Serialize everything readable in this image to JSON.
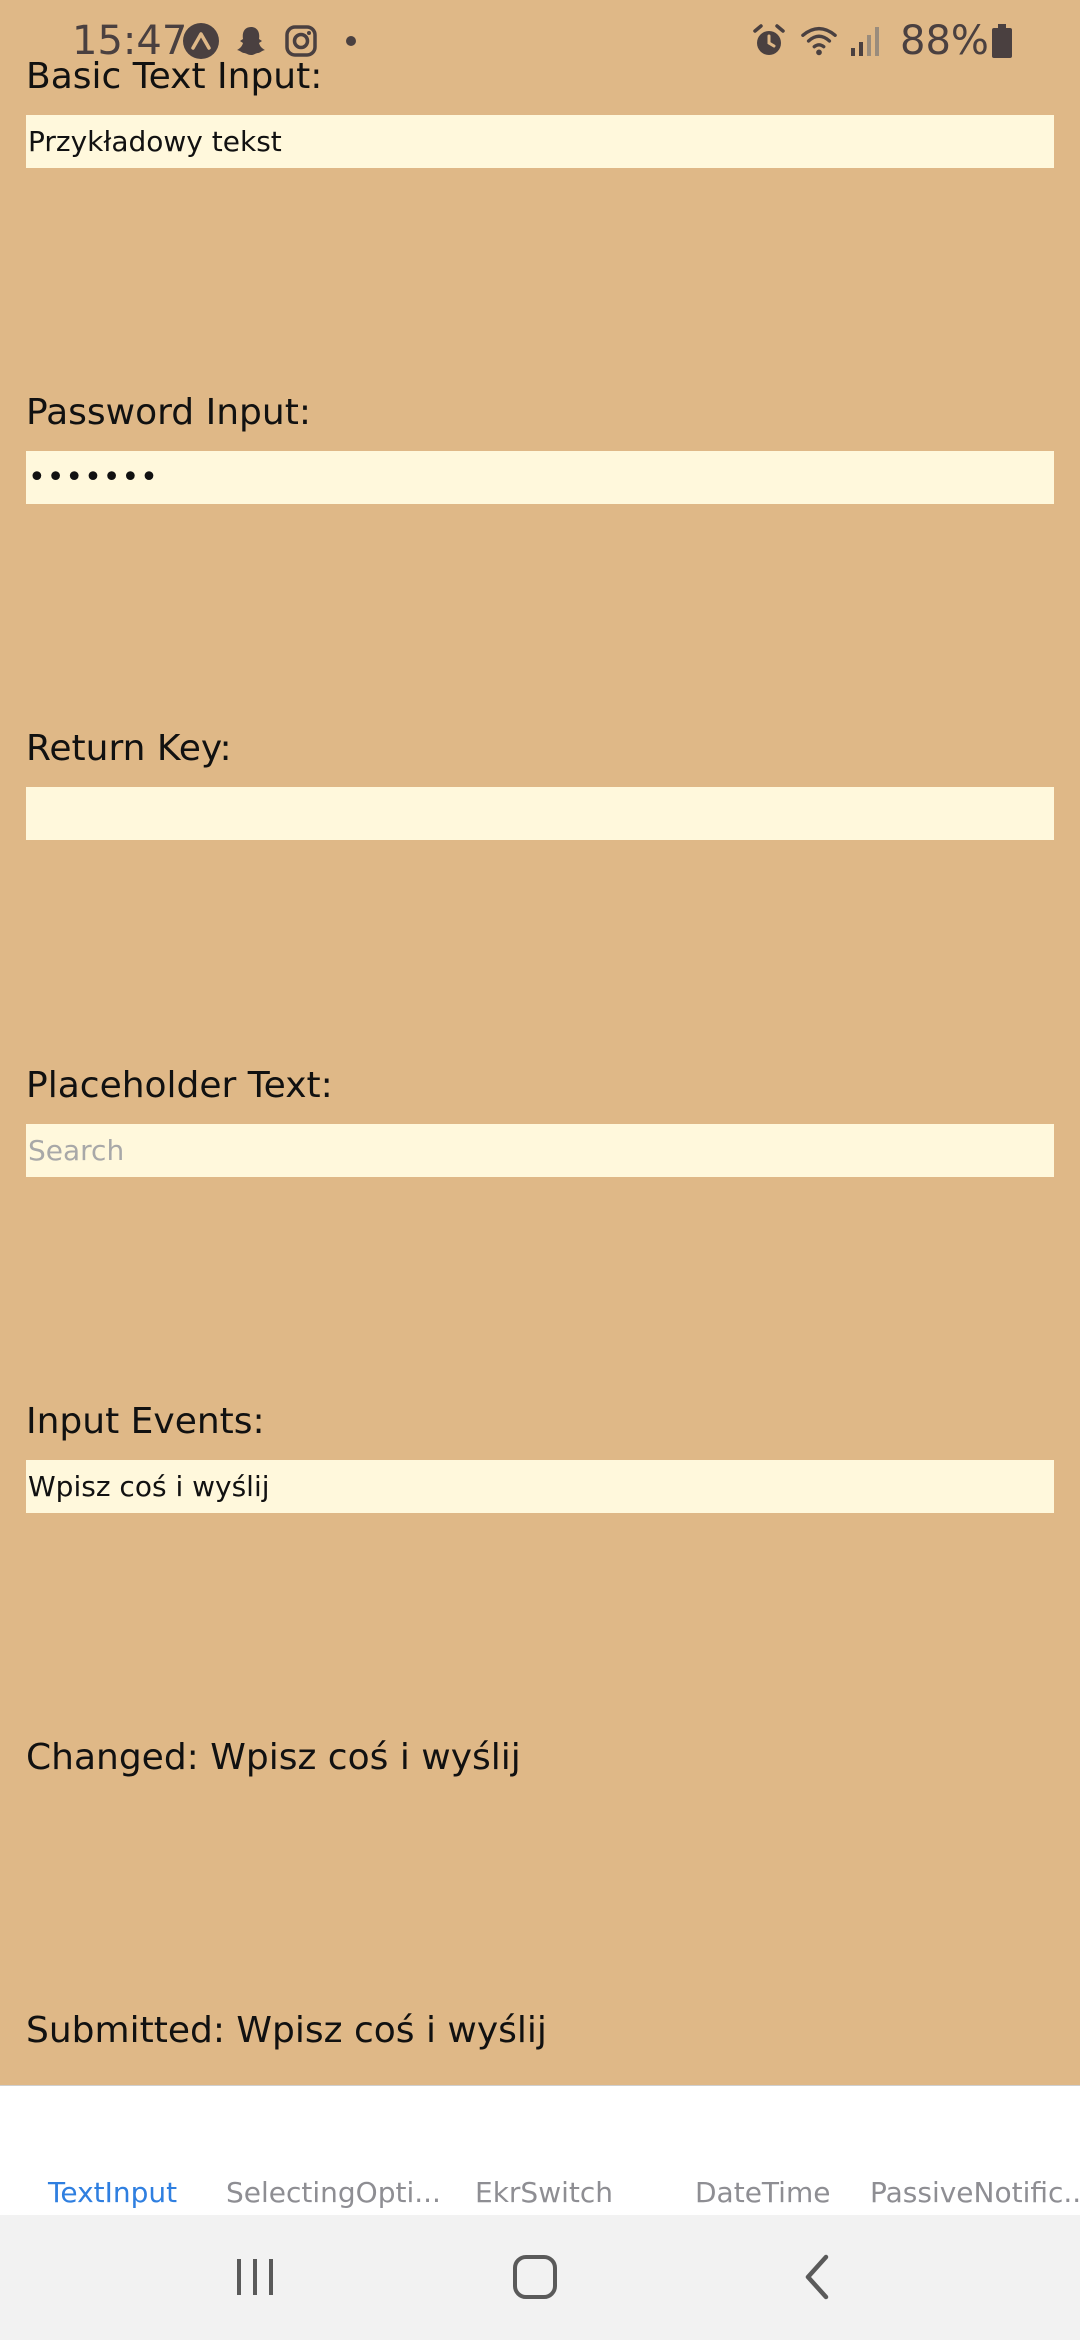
{
  "status_bar": {
    "time": "15:47",
    "battery": "88%",
    "icons": [
      "expo-icon",
      "snapchat-icon",
      "instagram-icon",
      "dot-icon",
      "alarm-icon",
      "wifi-icon",
      "signal-icon",
      "battery-icon"
    ]
  },
  "form": {
    "basic": {
      "label": "Basic Text Input:",
      "value": "Przykładowy tekst"
    },
    "password": {
      "label": "Password Input:",
      "value": "•••••••"
    },
    "return_key": {
      "label": "Return Key:",
      "value": ""
    },
    "placeholder": {
      "label": "Placeholder Text:",
      "placeholder": "Search"
    },
    "events": {
      "label": "Input Events:",
      "value": "Wpisz coś i wyślij"
    },
    "changed": "Changed: Wpisz coś i wyślij",
    "submitted": "Submitted: Wpisz coś i wyślij"
  },
  "tabs": [
    {
      "label": "TextInput",
      "active": true
    },
    {
      "label": "SelectingOpti...",
      "active": false
    },
    {
      "label": "EkrSwitch",
      "active": false
    },
    {
      "label": "DateTime",
      "active": false
    },
    {
      "label": "PassiveNotific...",
      "active": false
    }
  ],
  "colors": {
    "background": "#dfb887",
    "input_background": "#fff8dc",
    "tab_active": "#2f7fe0",
    "tab_inactive": "#8e8e93"
  }
}
